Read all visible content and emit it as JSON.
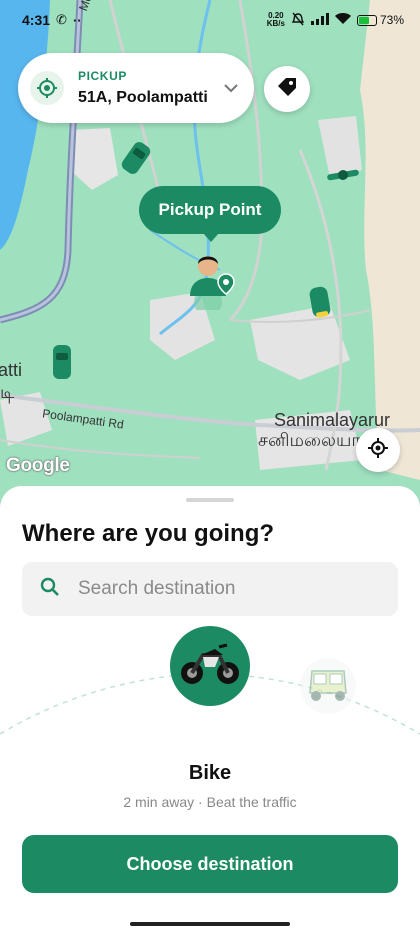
{
  "status_bar": {
    "time": "4:31",
    "net_speed_value": "0.20",
    "net_speed_unit": "KB/s",
    "battery": "73",
    "battery_level": 0.73
  },
  "pickup": {
    "label": "PICKUP",
    "address": "51A, Poolampatti"
  },
  "map": {
    "pickup_bubble": "Pickup Point",
    "labels": {
      "road_top": "Mettur",
      "road_poolampatti": "Poolampatti Rd",
      "town": "Sanimalayarur",
      "town_tamil": "சனிமலையார்",
      "left_partial": "atti",
      "left_partial_tamil": "டி",
      "google": "Google"
    }
  },
  "sheet": {
    "title": "Where are you going?",
    "search_placeholder": "Search destination",
    "vehicle_name": "Bike",
    "vehicle_subtitle": "2 min away · Beat the traffic",
    "cta_label": "Choose destination"
  },
  "colors": {
    "brand": "#1c8b63",
    "map_green": "#9fe0bf",
    "water": "#58b6ee"
  },
  "icons": [
    "call-icon",
    "more-icon",
    "mute-icon",
    "signal-icon",
    "wifi-icon",
    "battery-icon",
    "location-pin-icon",
    "chevron-down-icon",
    "tag-icon",
    "my-location-icon",
    "search-icon",
    "bike-icon",
    "auto-rickshaw-icon"
  ]
}
